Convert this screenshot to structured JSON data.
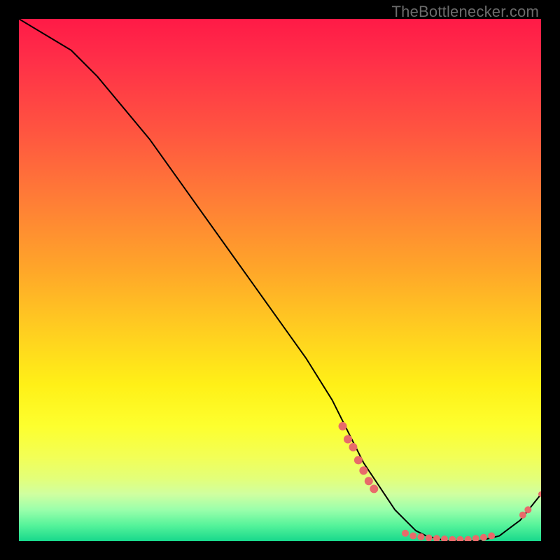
{
  "watermark": "TheBottlenecker.com",
  "chart_data": {
    "type": "line",
    "title": "",
    "xlabel": "",
    "ylabel": "",
    "xlim": [
      0,
      100
    ],
    "ylim": [
      0,
      100
    ],
    "background_gradient": {
      "orientation": "vertical",
      "stops": [
        {
          "pos": 0.0,
          "color": "#ff1a47"
        },
        {
          "pos": 0.08,
          "color": "#ff2f48"
        },
        {
          "pos": 0.22,
          "color": "#ff5640"
        },
        {
          "pos": 0.35,
          "color": "#ff7e36"
        },
        {
          "pos": 0.48,
          "color": "#ffa629"
        },
        {
          "pos": 0.6,
          "color": "#ffcf20"
        },
        {
          "pos": 0.7,
          "color": "#fff017"
        },
        {
          "pos": 0.78,
          "color": "#fdff2e"
        },
        {
          "pos": 0.84,
          "color": "#f2ff57"
        },
        {
          "pos": 0.88,
          "color": "#e3ff79"
        },
        {
          "pos": 0.91,
          "color": "#d0ffa0"
        },
        {
          "pos": 0.94,
          "color": "#9affab"
        },
        {
          "pos": 0.97,
          "color": "#55f39a"
        },
        {
          "pos": 1.0,
          "color": "#18d88c"
        }
      ]
    },
    "series": [
      {
        "name": "bottleneck-curve",
        "color": "#000000",
        "x": [
          0,
          5,
          10,
          15,
          20,
          25,
          30,
          35,
          40,
          45,
          50,
          55,
          60,
          62,
          64,
          66,
          68,
          70,
          72,
          74,
          76,
          78,
          80,
          82,
          84,
          86,
          88,
          90,
          92,
          94,
          96,
          98,
          100
        ],
        "y": [
          100,
          97,
          94,
          89,
          83,
          77,
          70,
          63,
          56,
          49,
          42,
          35,
          27,
          23,
          19,
          15,
          12,
          9,
          6,
          4,
          2,
          1,
          0.5,
          0,
          0,
          0,
          0,
          0.5,
          1,
          2.5,
          4,
          6.5,
          9
        ]
      }
    ],
    "markers": [
      {
        "name": "cluster-left-1",
        "x": 62.0,
        "y": 22.0,
        "r": 6,
        "color": "#e86a6a"
      },
      {
        "name": "cluster-left-2",
        "x": 63.0,
        "y": 19.5,
        "r": 6,
        "color": "#e86a6a"
      },
      {
        "name": "cluster-left-3",
        "x": 64.0,
        "y": 18.0,
        "r": 6,
        "color": "#e86a6a"
      },
      {
        "name": "cluster-left-4",
        "x": 65.0,
        "y": 15.5,
        "r": 6,
        "color": "#e86a6a"
      },
      {
        "name": "cluster-left-5",
        "x": 66.0,
        "y": 13.5,
        "r": 6,
        "color": "#e86a6a"
      },
      {
        "name": "cluster-left-6",
        "x": 67.0,
        "y": 11.5,
        "r": 6,
        "color": "#e86a6a"
      },
      {
        "name": "cluster-left-7",
        "x": 68.0,
        "y": 10.0,
        "r": 6,
        "color": "#e86a6a"
      },
      {
        "name": "trough-1",
        "x": 74.0,
        "y": 1.5,
        "r": 5,
        "color": "#e86a6a"
      },
      {
        "name": "trough-2",
        "x": 75.5,
        "y": 1.0,
        "r": 5,
        "color": "#e86a6a"
      },
      {
        "name": "trough-3",
        "x": 77.0,
        "y": 0.8,
        "r": 5,
        "color": "#e86a6a"
      },
      {
        "name": "trough-4",
        "x": 78.5,
        "y": 0.6,
        "r": 5,
        "color": "#e86a6a"
      },
      {
        "name": "trough-5",
        "x": 80.0,
        "y": 0.5,
        "r": 5,
        "color": "#e86a6a"
      },
      {
        "name": "trough-6",
        "x": 81.5,
        "y": 0.4,
        "r": 5,
        "color": "#e86a6a"
      },
      {
        "name": "trough-7",
        "x": 83.0,
        "y": 0.3,
        "r": 5,
        "color": "#e86a6a"
      },
      {
        "name": "trough-8",
        "x": 84.5,
        "y": 0.3,
        "r": 5,
        "color": "#e86a6a"
      },
      {
        "name": "trough-9",
        "x": 86.0,
        "y": 0.3,
        "r": 5,
        "color": "#e86a6a"
      },
      {
        "name": "trough-10",
        "x": 87.5,
        "y": 0.5,
        "r": 5,
        "color": "#e86a6a"
      },
      {
        "name": "trough-11",
        "x": 89.0,
        "y": 0.7,
        "r": 5,
        "color": "#e86a6a"
      },
      {
        "name": "trough-12",
        "x": 90.5,
        "y": 1.0,
        "r": 5,
        "color": "#e86a6a"
      },
      {
        "name": "right-1",
        "x": 96.5,
        "y": 5.0,
        "r": 5,
        "color": "#e86a6a"
      },
      {
        "name": "right-2",
        "x": 97.5,
        "y": 6.0,
        "r": 5,
        "color": "#e86a6a"
      },
      {
        "name": "right-end",
        "x": 100.0,
        "y": 9.0,
        "r": 4,
        "color": "#e86a6a"
      }
    ]
  }
}
